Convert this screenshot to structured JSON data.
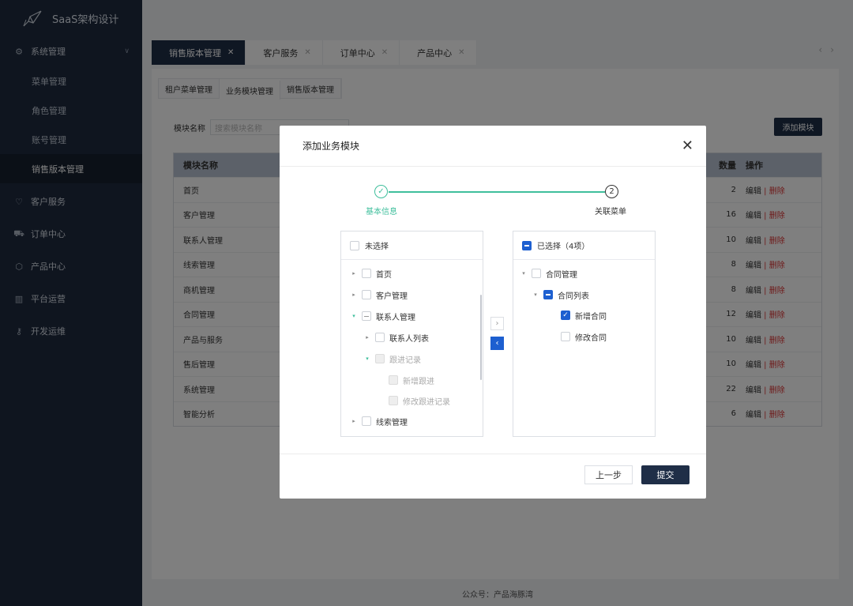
{
  "app": {
    "title": "SaaS架构设计"
  },
  "sidebar": {
    "group_system": "系统管理",
    "sub_items": [
      {
        "label": "菜单管理"
      },
      {
        "label": "角色管理"
      },
      {
        "label": "账号管理"
      },
      {
        "label": "销售版本管理"
      }
    ],
    "groups": [
      {
        "label": "客户服务"
      },
      {
        "label": "订单中心"
      },
      {
        "label": "产品中心"
      },
      {
        "label": "平台运营"
      },
      {
        "label": "开发运维"
      }
    ]
  },
  "tabs": [
    {
      "label": "销售版本管理"
    },
    {
      "label": "客户服务"
    },
    {
      "label": "订单中心"
    },
    {
      "label": "产品中心"
    }
  ],
  "subtabs": [
    "租户菜单管理",
    "业务模块管理",
    "销售版本管理"
  ],
  "search": {
    "label": "模块名称",
    "placeholder": "搜索模块名称"
  },
  "add_button": "添加模块",
  "table": {
    "headers": {
      "name": "模块名称",
      "count_partial": "数量",
      "actions": "操作"
    },
    "edit_label": "编辑",
    "delete_label": "删除",
    "rows": [
      {
        "name": "首页",
        "count": "2"
      },
      {
        "name": "客户管理",
        "count": "16"
      },
      {
        "name": "联系人管理",
        "count": "10"
      },
      {
        "name": "线索管理",
        "count": "8"
      },
      {
        "name": "商机管理",
        "count": "8"
      },
      {
        "name": "合同管理",
        "count": "12"
      },
      {
        "name": "产品与服务",
        "count": "10"
      },
      {
        "name": "售后管理",
        "count": "10"
      },
      {
        "name": "系统管理",
        "count": "22"
      },
      {
        "name": "智能分析",
        "count": "6"
      }
    ]
  },
  "footer": "公众号：产品海豚湾",
  "modal": {
    "title": "添加业务模块",
    "steps": [
      {
        "index": "✓",
        "label": "基本信息"
      },
      {
        "index": "2",
        "label": "关联菜单"
      }
    ],
    "left_header": "未选择",
    "left_items": [
      {
        "label": "首页"
      },
      {
        "label": "客户管理"
      },
      {
        "label": "联系人管理"
      },
      {
        "label": "联系人列表"
      },
      {
        "label": "跟进记录"
      },
      {
        "label": "新增跟进"
      },
      {
        "label": "修改跟进记录"
      },
      {
        "label": "线索管理"
      }
    ],
    "right_header": "已选择（4项）",
    "right_items": [
      {
        "label": "合同管理"
      },
      {
        "label": "合同列表"
      },
      {
        "label": "新增合同"
      },
      {
        "label": "修改合同"
      }
    ],
    "prev_button": "上一步",
    "submit_button": "提交"
  },
  "colors": {
    "primary": "#1f2e47",
    "accent": "#3fbf9c",
    "check": "#1d5fd0",
    "danger": "#dd3333"
  }
}
